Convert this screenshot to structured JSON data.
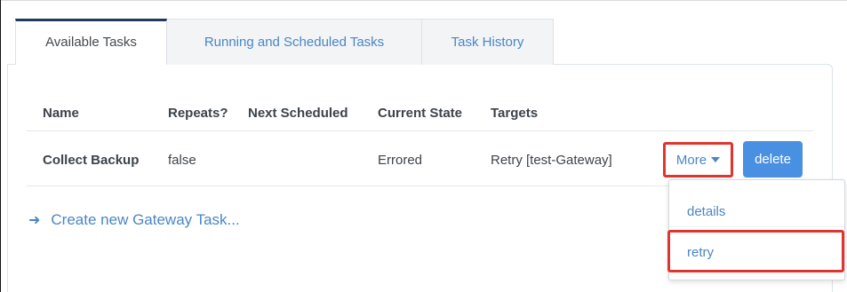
{
  "tabs": [
    {
      "label": "Available Tasks",
      "active": true
    },
    {
      "label": "Running and Scheduled Tasks",
      "active": false
    },
    {
      "label": "Task History",
      "active": false
    }
  ],
  "table": {
    "headers": [
      "Name",
      "Repeats?",
      "Next Scheduled",
      "Current State",
      "Targets"
    ],
    "rows": [
      {
        "name": "Collect Backup",
        "repeats": "false",
        "next_scheduled": "",
        "current_state": "Errored",
        "targets": "Retry [test-Gateway]"
      }
    ]
  },
  "actions": {
    "more_label": "More",
    "delete_label": "delete"
  },
  "dropdown": {
    "items": [
      "details",
      "retry"
    ]
  },
  "create_link": {
    "label": "Create new Gateway Task...",
    "icon": "arrow-right-icon"
  },
  "colors": {
    "accent": "#4a86c5",
    "button": "#4a90e2",
    "highlight": "#e0352f",
    "active_tab_border": "#1f3b57"
  }
}
